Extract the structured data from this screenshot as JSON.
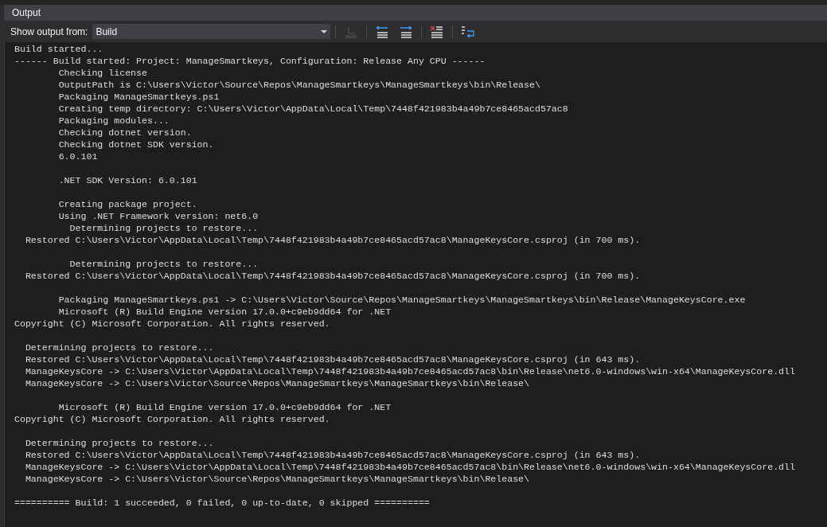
{
  "panel": {
    "title": "Output"
  },
  "toolbar": {
    "label": "Show output from:",
    "source": "Build",
    "buttons": [
      {
        "kind": "goto",
        "disabled": true
      },
      {
        "kind": "prev",
        "disabled": false
      },
      {
        "kind": "next",
        "disabled": false
      },
      {
        "kind": "clear",
        "disabled": false
      },
      {
        "kind": "wrap",
        "disabled": false
      }
    ]
  },
  "output": {
    "blocks": [
      [
        "Build started...",
        "------ Build started: Project: ManageSmartkeys, Configuration: Release Any CPU ------",
        "        Checking license",
        "        OutputPath is C:\\Users\\Victor\\Source\\Repos\\ManageSmartkeys\\ManageSmartkeys\\bin\\Release\\",
        "        Packaging ManageSmartkeys.ps1",
        "        Creating temp directory: C:\\Users\\Victor\\AppData\\Local\\Temp\\7448f421983b4a49b7ce8465acd57ac8",
        "        Packaging modules...",
        "        Checking dotnet version.",
        "        Checking dotnet SDK version.",
        "        6.0.101"
      ],
      [
        "        .NET SDK Version: 6.0.101"
      ],
      [
        "        Creating package project.",
        "        Using .NET Framework version: net6.0",
        "          Determining projects to restore...",
        "  Restored C:\\Users\\Victor\\AppData\\Local\\Temp\\7448f421983b4a49b7ce8465acd57ac8\\ManageKeysCore.csproj (in 700 ms)."
      ],
      [
        "          Determining projects to restore...",
        "  Restored C:\\Users\\Victor\\AppData\\Local\\Temp\\7448f421983b4a49b7ce8465acd57ac8\\ManageKeysCore.csproj (in 700 ms)."
      ],
      [
        "        Packaging ManageSmartkeys.ps1 -> C:\\Users\\Victor\\Source\\Repos\\ManageSmartkeys\\ManageSmartkeys\\bin\\Release\\ManageKeysCore.exe",
        "        Microsoft (R) Build Engine version 17.0.0+c9eb9dd64 for .NET",
        "Copyright (C) Microsoft Corporation. All rights reserved."
      ],
      [
        "  Determining projects to restore...",
        "  Restored C:\\Users\\Victor\\AppData\\Local\\Temp\\7448f421983b4a49b7ce8465acd57ac8\\ManageKeysCore.csproj (in 643 ms).",
        "  ManageKeysCore -> C:\\Users\\Victor\\AppData\\Local\\Temp\\7448f421983b4a49b7ce8465acd57ac8\\bin\\Release\\net6.0-windows\\win-x64\\ManageKeysCore.dll",
        "  ManageKeysCore -> C:\\Users\\Victor\\Source\\Repos\\ManageSmartkeys\\ManageSmartkeys\\bin\\Release\\"
      ],
      [
        "        Microsoft (R) Build Engine version 17.0.0+c9eb9dd64 for .NET",
        "Copyright (C) Microsoft Corporation. All rights reserved."
      ],
      [
        "  Determining projects to restore...",
        "  Restored C:\\Users\\Victor\\AppData\\Local\\Temp\\7448f421983b4a49b7ce8465acd57ac8\\ManageKeysCore.csproj (in 643 ms).",
        "  ManageKeysCore -> C:\\Users\\Victor\\AppData\\Local\\Temp\\7448f421983b4a49b7ce8465acd57ac8\\bin\\Release\\net6.0-windows\\win-x64\\ManageKeysCore.dll",
        "  ManageKeysCore -> C:\\Users\\Victor\\Source\\Repos\\ManageSmartkeys\\ManageSmartkeys\\bin\\Release\\"
      ],
      [
        "========== Build: 1 succeeded, 0 failed, 0 up-to-date, 0 skipped =========="
      ]
    ]
  }
}
